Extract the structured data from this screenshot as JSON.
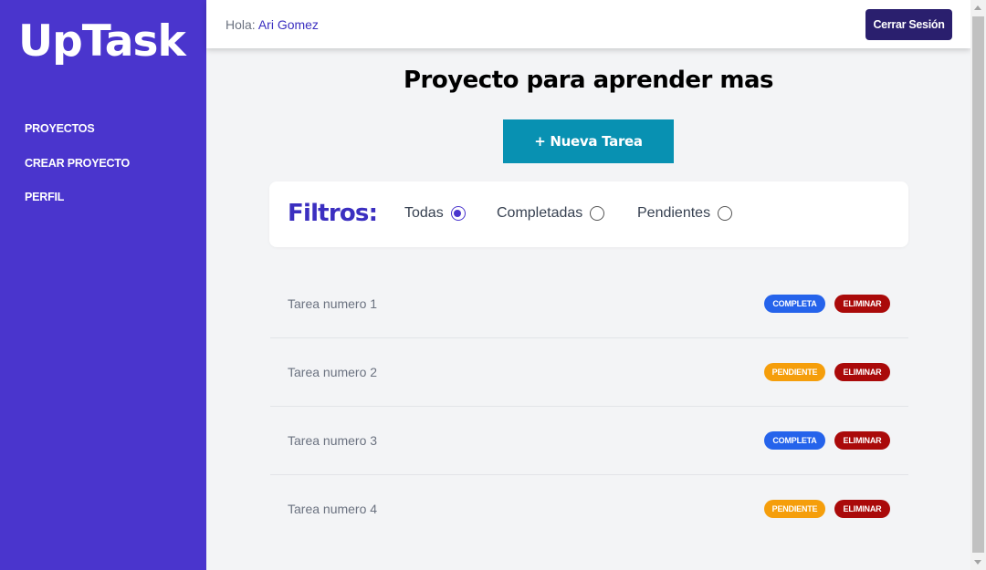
{
  "app": {
    "logo": "UpTask"
  },
  "sidebar": {
    "items": [
      {
        "label": "PROYECTOS"
      },
      {
        "label": "CREAR PROYECTO"
      },
      {
        "label": "PERFIL"
      }
    ]
  },
  "header": {
    "greeting_prefix": "Hola: ",
    "user_name": "Ari Gomez",
    "logout_label": "Cerrar Sesión"
  },
  "main": {
    "title": "Proyecto para aprender mas",
    "new_task_label": "+ Nueva Tarea"
  },
  "filters": {
    "title": "Filtros:",
    "options": [
      {
        "label": "Todas",
        "checked": true
      },
      {
        "label": "Completadas",
        "checked": false
      },
      {
        "label": "Pendientes",
        "checked": false
      }
    ]
  },
  "tasks": [
    {
      "name": "Tarea numero 1",
      "status": "COMPLETA",
      "delete": "ELIMINAR"
    },
    {
      "name": "Tarea numero 2",
      "status": "PENDIENTE",
      "delete": "ELIMINAR"
    },
    {
      "name": "Tarea numero 3",
      "status": "COMPLETA",
      "delete": "ELIMINAR"
    },
    {
      "name": "Tarea numero 4",
      "status": "PENDIENTE",
      "delete": "ELIMINAR"
    }
  ],
  "colors": {
    "sidebar": "#4a35cd",
    "accent": "#3b2fc0",
    "logout": "#2a1f6e",
    "new_task": "#0891b2",
    "completa": "#2563eb",
    "pendiente": "#f59e0b",
    "eliminar": "#aa0a0a"
  }
}
